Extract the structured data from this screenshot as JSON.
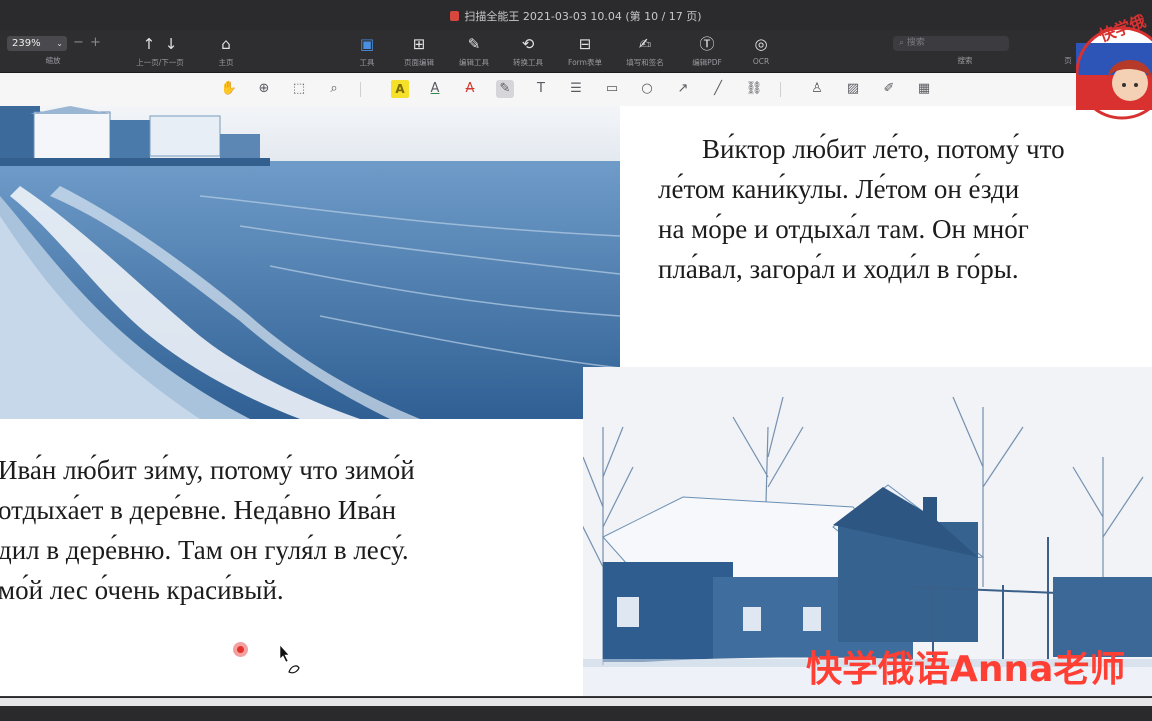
{
  "window": {
    "title": "扫描全能王 2021-03-03 10.04 (第 10 / 17 页)"
  },
  "toolbar": {
    "zoom_value": "239%",
    "zoom_caption": "缩放",
    "nav_caption": "上一页/下一页",
    "home_caption": "主页",
    "tools": [
      {
        "label": "工具",
        "icon": "toolbox-icon"
      },
      {
        "label": "页面编辑",
        "icon": "grid-icon"
      },
      {
        "label": "编辑工具",
        "icon": "edit-icon"
      },
      {
        "label": "转换工具",
        "icon": "convert-icon"
      },
      {
        "label": "Form表单",
        "icon": "form-icon"
      },
      {
        "label": "填写和签名",
        "icon": "sign-icon"
      },
      {
        "label": "编辑PDF",
        "icon": "text-edit-icon"
      },
      {
        "label": "OCR",
        "icon": "ocr-icon"
      }
    ],
    "search_placeholder": "搜索",
    "search_caption": "搜索",
    "right_caption": "页"
  },
  "document": {
    "paragraph_summer": [
      "Ви́ктор лю́бит ле́то, потому́ что",
      "ле́том кани́кулы. Ле́том он е́зди",
      "на мо́ре и отдыха́л там. Он мно́г",
      "пла́вал, загора́л и ходи́л в го́ры."
    ],
    "paragraph_winter": [
      " Ива́н лю́бит зи́му, потому́ что зимо́й",
      " отдыха́ет в дере́вне. Неда́вно Ива́н",
      "дил в дере́вню. Там он гуля́л в лесу́.",
      "мо́й лес о́чень краси́вый."
    ]
  },
  "overlay": {
    "watermark": "快学俄语Anna老师",
    "avatar_text": "快学俄"
  },
  "colors": {
    "accent_watermark": "#ff3f33",
    "highlight_tool": "#f5e12a",
    "photo_tint": "#3b6aa0"
  }
}
